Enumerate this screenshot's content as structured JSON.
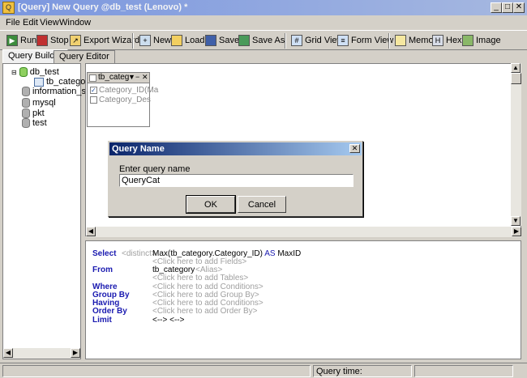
{
  "window": {
    "title": "[Query] New Query @db_test (Lenovo) *"
  },
  "menu": [
    "File",
    "Edit",
    "View",
    "Window"
  ],
  "toolbar": {
    "run": "Run",
    "stop": "Stop",
    "export": "Export Wizard",
    "new": "New",
    "load": "Load",
    "save": "Save",
    "save_as": "Save As",
    "grid_view": "Grid View",
    "form_view": "Form View",
    "memo": "Memo",
    "hex": "Hex",
    "image": "Image"
  },
  "tabs": [
    "Query Builder",
    "Query Editor"
  ],
  "tree": {
    "items": [
      "db_test",
      "tb_categor",
      "information_sch",
      "mysql",
      "pkt",
      "test"
    ]
  },
  "table_box": {
    "name": "tb_categ",
    "fields": [
      "Category_ID(Ma",
      "Category_Des"
    ],
    "checked": [
      true,
      false
    ]
  },
  "sql": {
    "select_kw": "Select",
    "distinct": "<distinct>",
    "select_expr": "Max(tb_category.Category_ID)",
    "as_kw": "AS",
    "alias": "MaxID",
    "add_fields": "<Click here to add Fields>",
    "from_kw": "From",
    "from_table": "tb_category",
    "from_alias": "<Alias>",
    "add_tables": "<Click here to add Tables>",
    "where_kw": "Where",
    "add_conditions": "<Click here to add Conditions>",
    "groupby_kw": "Group By",
    "add_groupby": "<Click here to add Group By>",
    "having_kw": "Having",
    "add_having": "<Click here to add Conditions>",
    "orderby_kw": "Order By",
    "add_orderby": "<Click here to add Order By>",
    "limit_kw": "Limit",
    "limit_val": "<--> <-->"
  },
  "dialog": {
    "title": "Query Name",
    "label": "Enter query name",
    "value": "QueryCat",
    "ok": "OK",
    "cancel": "Cancel"
  },
  "status": {
    "query_time": "Query time:"
  }
}
